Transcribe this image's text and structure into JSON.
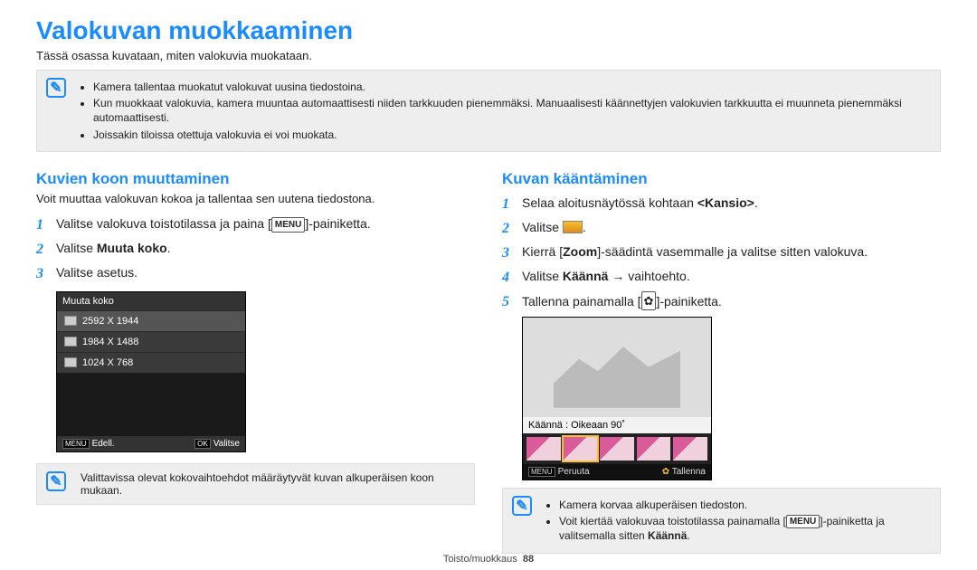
{
  "page": {
    "title": "Valokuvan muokkaaminen",
    "intro": "Tässä osassa kuvataan, miten valokuvia muokataan.",
    "footer": "Toisto/muokkaus",
    "page_num": "88"
  },
  "top_note": {
    "items": [
      "Kamera tallentaa muokatut valokuvat uusina tiedostoina.",
      "Kun muokkaat valokuvia, kamera muuntaa automaattisesti niiden tarkkuuden pienemmäksi. Manuaalisesti käännettyjen valokuvien tarkkuutta ei muunneta pienemmäksi automaattisesti.",
      "Joissakin tiloissa otettuja valokuvia ei voi muokata."
    ]
  },
  "left": {
    "heading": "Kuvien koon muuttaminen",
    "sub": "Voit muuttaa valokuvan kokoa ja tallentaa sen uutena tiedostona.",
    "step1_a": "Valitse valokuva toistotilassa ja paina [",
    "step1_b": "]-painiketta.",
    "step2_a": "Valitse ",
    "step2_b": "Muuta koko",
    "step2_c": ".",
    "step3": "Valitse asetus.",
    "menu_label": "MENU",
    "device": {
      "title": "Muuta koko",
      "options": [
        "2592 X 1944",
        "1984 X 1488",
        "1024 X 768"
      ],
      "footer_left_tag": "MENU",
      "footer_left": "Edell.",
      "footer_right_tag": "OK",
      "footer_right": "Valitse"
    },
    "bottom_note": "Valittavissa olevat kokovaihtoehdot määräytyvät kuvan alkuperäisen koon mukaan."
  },
  "right": {
    "heading": "Kuvan kääntäminen",
    "step1_a": "Selaa aloitusnäytössä kohtaan ",
    "step1_b": "<Kansio>",
    "step1_c": ".",
    "step2": "Valitse ",
    "step2_end": ".",
    "step3_a": "Kierrä [",
    "step3_b": "Zoom",
    "step3_c": "]-säädintä vasemmalle ja valitse sitten valokuva.",
    "step4_a": "Valitse ",
    "step4_b": "Käännä",
    "step4_c": " → vaihtoehto.",
    "step5_a": "Tallenna painamalla [",
    "step5_b": "]-painiketta.",
    "device": {
      "caption": "Käännä : Oikeaan 90˚",
      "footer_left_tag": "MENU",
      "footer_left": "Peruuta",
      "footer_right": "Tallenna"
    },
    "bottom_note": {
      "items": [
        "Kamera korvaa alkuperäisen tiedoston.",
        {
          "a": "Voit kiertää valokuvaa toistotilassa painamalla [",
          "b": "]-painiketta ja valitsemalla sitten ",
          "c": "Käännä",
          "d": "."
        }
      ]
    },
    "menu_label": "MENU"
  }
}
